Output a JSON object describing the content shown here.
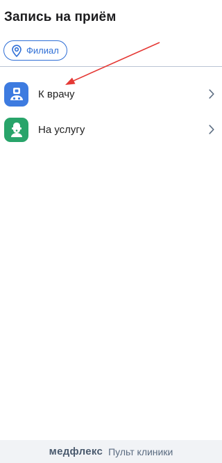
{
  "header": {
    "title": "Запись на приём"
  },
  "branch_filter": {
    "label": "Филиал",
    "icon": "location-pin-icon"
  },
  "menu": [
    {
      "label": "К врачу",
      "icon": "doctor-icon",
      "tile_color": "#3d7be0"
    },
    {
      "label": "На услугу",
      "icon": "service-icon",
      "tile_color": "#28a46a"
    }
  ],
  "footer": {
    "brand": "медфлекс",
    "subtitle": "Пульт клиники"
  },
  "colors": {
    "accent": "#2f6fd6",
    "annotation_arrow": "#e53935"
  }
}
